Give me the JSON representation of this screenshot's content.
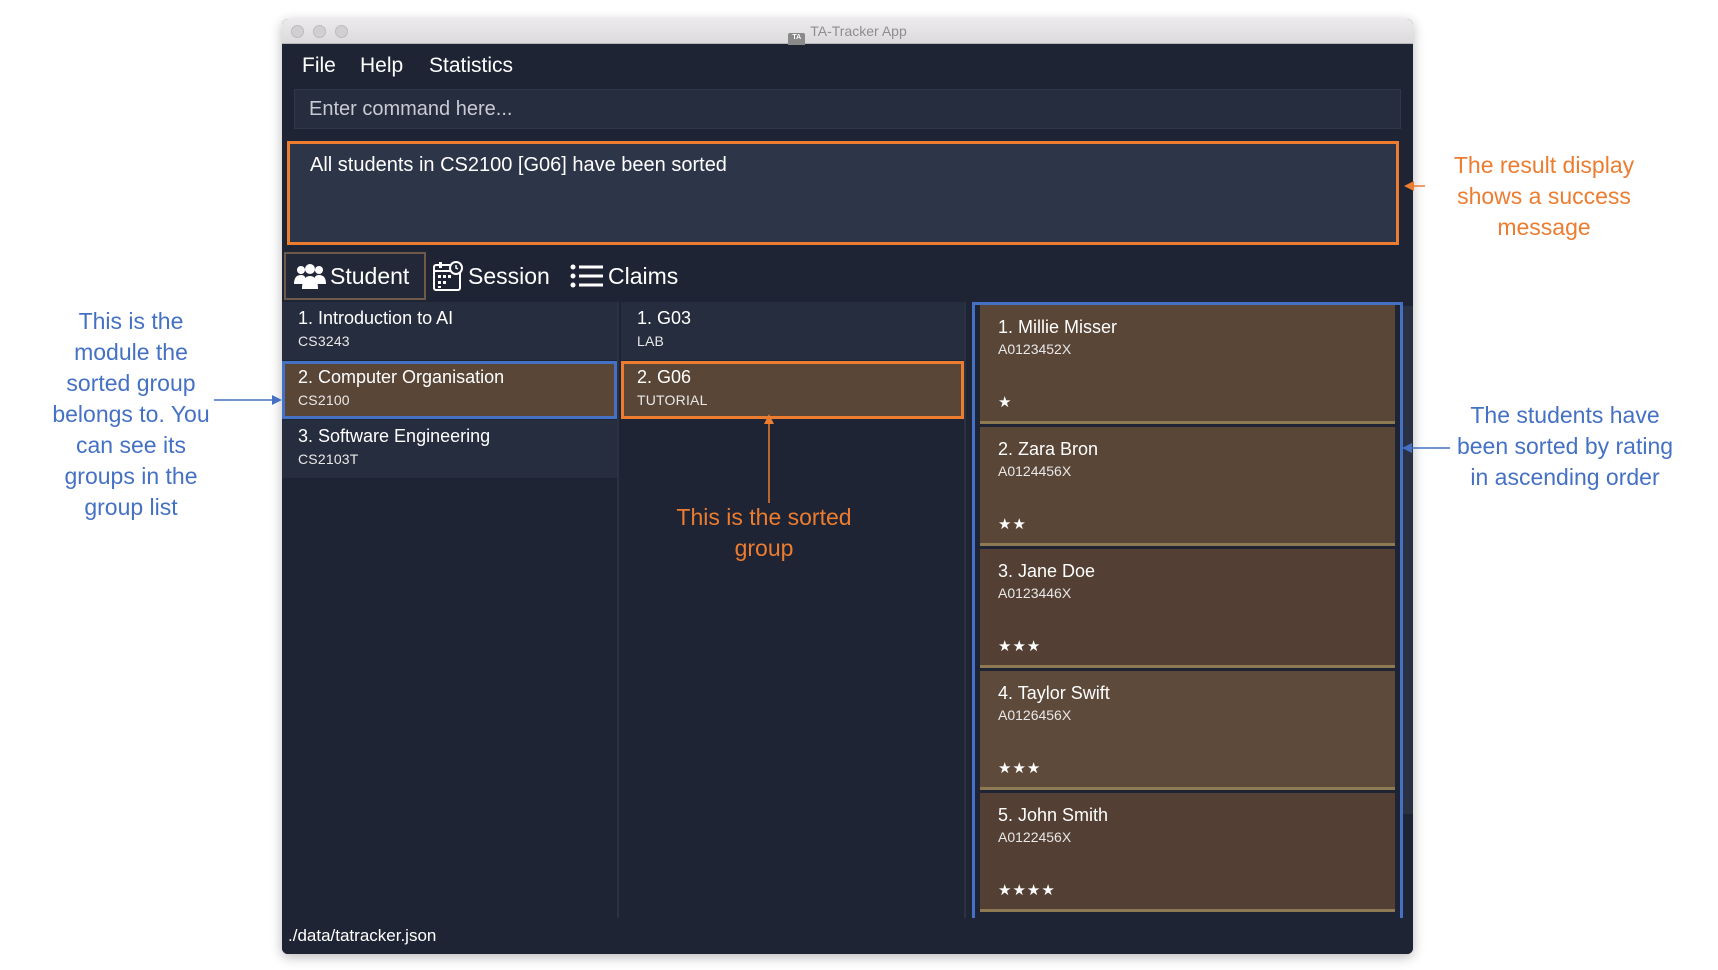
{
  "window": {
    "title": "TA-Tracker App",
    "icon_text": "TA"
  },
  "menu": [
    "File",
    "Help",
    "Statistics"
  ],
  "command_box": {
    "placeholder": "Enter command here..."
  },
  "result_display": {
    "text": "All students in CS2100 [G06] have been sorted"
  },
  "tabs": [
    {
      "label": "Student",
      "icon": "students-icon",
      "selected": true
    },
    {
      "label": "Session",
      "icon": "calendar-icon",
      "selected": false
    },
    {
      "label": "Claims",
      "icon": "list-icon",
      "selected": false
    }
  ],
  "modules": [
    {
      "name": "1.  Introduction to AI",
      "code": "CS3243",
      "selected": false
    },
    {
      "name": "2.  Computer Organisation",
      "code": "CS2100",
      "selected": true
    },
    {
      "name": "3.  Software Engineering",
      "code": "CS2103T",
      "selected": false
    }
  ],
  "groups": [
    {
      "name": "1.  G03",
      "type": "LAB",
      "selected": false
    },
    {
      "name": "2.  G06",
      "type": "TUTORIAL",
      "selected": true
    }
  ],
  "students": [
    {
      "name": "1.  Millie Misser",
      "id": "A0123452X",
      "rating": "★"
    },
    {
      "name": "2.  Zara Bron",
      "id": "A0124456X",
      "rating": "★★"
    },
    {
      "name": "3.  Jane Doe",
      "id": "A0123446X",
      "rating": "★★★"
    },
    {
      "name": "4.  Taylor Swift",
      "id": "A0126456X",
      "rating": "★★★"
    },
    {
      "name": "5.  John Smith",
      "id": "A0122456X",
      "rating": "★★★★"
    }
  ],
  "status_bar": {
    "path": "./data/tatracker.json"
  },
  "annotations": {
    "result": "The result display\nshows a success\nmessage",
    "module": "This is the\nmodule the\nsorted group\nbelongs to. You\ncan see its\ngroups in the\ngroup list",
    "group": "This is the sorted\ngroup",
    "students": "The students have\nbeen sorted by rating\nin ascending order"
  },
  "colors": {
    "highlight_orange": "#ec7c30",
    "highlight_blue": "#4571c4",
    "selected_cell": "#5a4637",
    "app_background": "#1e2433"
  }
}
